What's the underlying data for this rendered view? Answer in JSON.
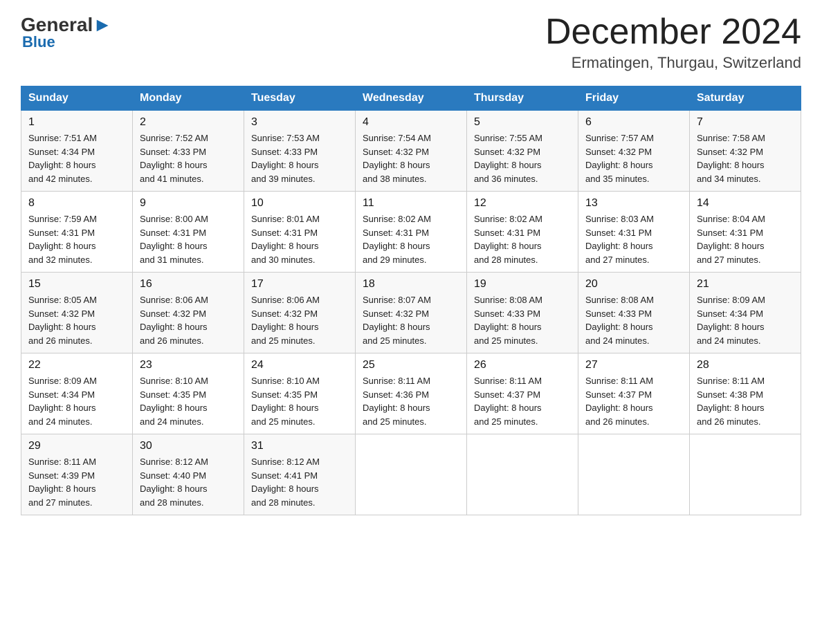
{
  "header": {
    "logo_general": "General",
    "logo_blue": "Blue",
    "month_year": "December 2024",
    "location": "Ermatingen, Thurgau, Switzerland"
  },
  "weekdays": [
    "Sunday",
    "Monday",
    "Tuesday",
    "Wednesday",
    "Thursday",
    "Friday",
    "Saturday"
  ],
  "weeks": [
    [
      {
        "day": "1",
        "sunrise": "7:51 AM",
        "sunset": "4:34 PM",
        "daylight": "8 hours and 42 minutes."
      },
      {
        "day": "2",
        "sunrise": "7:52 AM",
        "sunset": "4:33 PM",
        "daylight": "8 hours and 41 minutes."
      },
      {
        "day": "3",
        "sunrise": "7:53 AM",
        "sunset": "4:33 PM",
        "daylight": "8 hours and 39 minutes."
      },
      {
        "day": "4",
        "sunrise": "7:54 AM",
        "sunset": "4:32 PM",
        "daylight": "8 hours and 38 minutes."
      },
      {
        "day": "5",
        "sunrise": "7:55 AM",
        "sunset": "4:32 PM",
        "daylight": "8 hours and 36 minutes."
      },
      {
        "day": "6",
        "sunrise": "7:57 AM",
        "sunset": "4:32 PM",
        "daylight": "8 hours and 35 minutes."
      },
      {
        "day": "7",
        "sunrise": "7:58 AM",
        "sunset": "4:32 PM",
        "daylight": "8 hours and 34 minutes."
      }
    ],
    [
      {
        "day": "8",
        "sunrise": "7:59 AM",
        "sunset": "4:31 PM",
        "daylight": "8 hours and 32 minutes."
      },
      {
        "day": "9",
        "sunrise": "8:00 AM",
        "sunset": "4:31 PM",
        "daylight": "8 hours and 31 minutes."
      },
      {
        "day": "10",
        "sunrise": "8:01 AM",
        "sunset": "4:31 PM",
        "daylight": "8 hours and 30 minutes."
      },
      {
        "day": "11",
        "sunrise": "8:02 AM",
        "sunset": "4:31 PM",
        "daylight": "8 hours and 29 minutes."
      },
      {
        "day": "12",
        "sunrise": "8:02 AM",
        "sunset": "4:31 PM",
        "daylight": "8 hours and 28 minutes."
      },
      {
        "day": "13",
        "sunrise": "8:03 AM",
        "sunset": "4:31 PM",
        "daylight": "8 hours and 27 minutes."
      },
      {
        "day": "14",
        "sunrise": "8:04 AM",
        "sunset": "4:31 PM",
        "daylight": "8 hours and 27 minutes."
      }
    ],
    [
      {
        "day": "15",
        "sunrise": "8:05 AM",
        "sunset": "4:32 PM",
        "daylight": "8 hours and 26 minutes."
      },
      {
        "day": "16",
        "sunrise": "8:06 AM",
        "sunset": "4:32 PM",
        "daylight": "8 hours and 26 minutes."
      },
      {
        "day": "17",
        "sunrise": "8:06 AM",
        "sunset": "4:32 PM",
        "daylight": "8 hours and 25 minutes."
      },
      {
        "day": "18",
        "sunrise": "8:07 AM",
        "sunset": "4:32 PM",
        "daylight": "8 hours and 25 minutes."
      },
      {
        "day": "19",
        "sunrise": "8:08 AM",
        "sunset": "4:33 PM",
        "daylight": "8 hours and 25 minutes."
      },
      {
        "day": "20",
        "sunrise": "8:08 AM",
        "sunset": "4:33 PM",
        "daylight": "8 hours and 24 minutes."
      },
      {
        "day": "21",
        "sunrise": "8:09 AM",
        "sunset": "4:34 PM",
        "daylight": "8 hours and 24 minutes."
      }
    ],
    [
      {
        "day": "22",
        "sunrise": "8:09 AM",
        "sunset": "4:34 PM",
        "daylight": "8 hours and 24 minutes."
      },
      {
        "day": "23",
        "sunrise": "8:10 AM",
        "sunset": "4:35 PM",
        "daylight": "8 hours and 24 minutes."
      },
      {
        "day": "24",
        "sunrise": "8:10 AM",
        "sunset": "4:35 PM",
        "daylight": "8 hours and 25 minutes."
      },
      {
        "day": "25",
        "sunrise": "8:11 AM",
        "sunset": "4:36 PM",
        "daylight": "8 hours and 25 minutes."
      },
      {
        "day": "26",
        "sunrise": "8:11 AM",
        "sunset": "4:37 PM",
        "daylight": "8 hours and 25 minutes."
      },
      {
        "day": "27",
        "sunrise": "8:11 AM",
        "sunset": "4:37 PM",
        "daylight": "8 hours and 26 minutes."
      },
      {
        "day": "28",
        "sunrise": "8:11 AM",
        "sunset": "4:38 PM",
        "daylight": "8 hours and 26 minutes."
      }
    ],
    [
      {
        "day": "29",
        "sunrise": "8:11 AM",
        "sunset": "4:39 PM",
        "daylight": "8 hours and 27 minutes."
      },
      {
        "day": "30",
        "sunrise": "8:12 AM",
        "sunset": "4:40 PM",
        "daylight": "8 hours and 28 minutes."
      },
      {
        "day": "31",
        "sunrise": "8:12 AM",
        "sunset": "4:41 PM",
        "daylight": "8 hours and 28 minutes."
      },
      null,
      null,
      null,
      null
    ]
  ],
  "labels": {
    "sunrise": "Sunrise:",
    "sunset": "Sunset:",
    "daylight": "Daylight:"
  }
}
